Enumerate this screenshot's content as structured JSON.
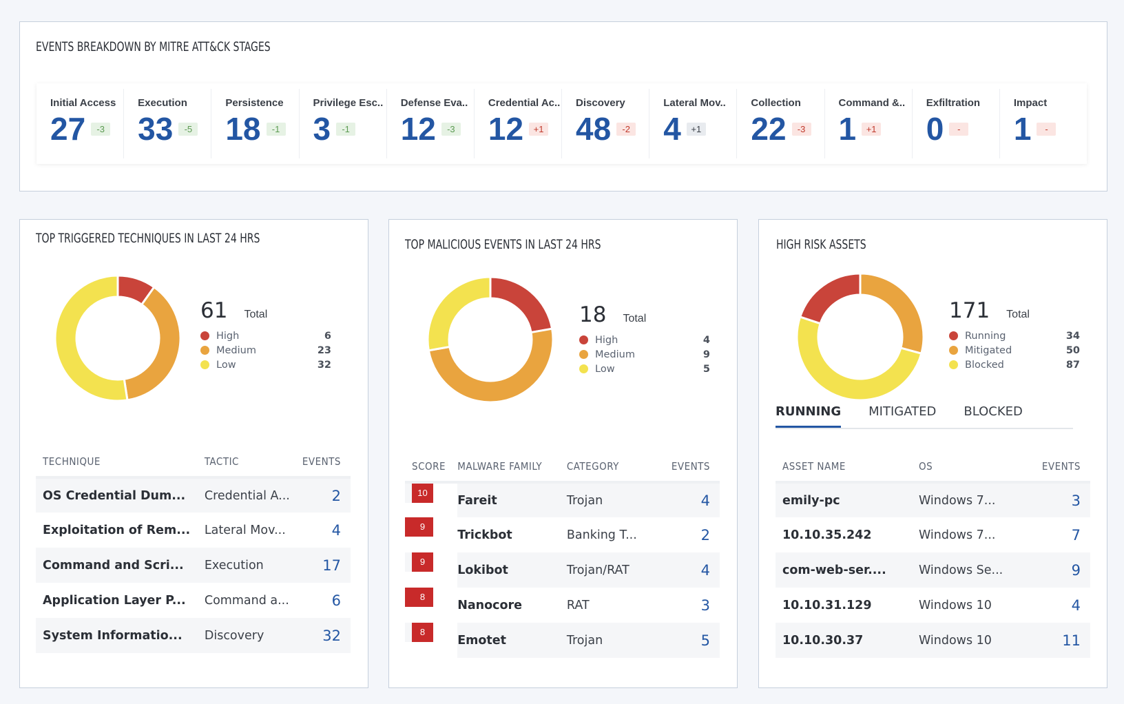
{
  "colors": {
    "high": "#c9443a",
    "medium": "#e9a43f",
    "low": "#f3e24f",
    "accent": "#2356a3"
  },
  "mitre": {
    "title": "EVENTS BREAKDOWN BY MITRE ATT&CK STAGES",
    "stages": [
      {
        "label": "Initial Access",
        "value": "27",
        "delta": "-3",
        "tone": "green"
      },
      {
        "label": "Execution",
        "value": "33",
        "delta": "-5",
        "tone": "green"
      },
      {
        "label": "Persistence",
        "value": "18",
        "delta": "-1",
        "tone": "green"
      },
      {
        "label": "Privilege Esc..",
        "value": "3",
        "delta": "-1",
        "tone": "green"
      },
      {
        "label": "Defense Eva..",
        "value": "12",
        "delta": "-3",
        "tone": "green"
      },
      {
        "label": "Credential Ac..",
        "value": "12",
        "delta": "+1",
        "tone": "red"
      },
      {
        "label": "Discovery",
        "value": "48",
        "delta": "-2",
        "tone": "red"
      },
      {
        "label": "Lateral Mov..",
        "value": "4",
        "delta": "+1",
        "tone": "gray"
      },
      {
        "label": "Collection",
        "value": "22",
        "delta": "-3",
        "tone": "red"
      },
      {
        "label": "Command &..",
        "value": "1",
        "delta": "+1",
        "tone": "red"
      },
      {
        "label": "Exfiltration",
        "value": "0",
        "delta": "-",
        "tone": "red"
      },
      {
        "label": "Impact",
        "value": "1",
        "delta": "-",
        "tone": "red"
      }
    ]
  },
  "techniques": {
    "title": "TOP TRIGGERED TECHNIQUES IN LAST 24 HRS",
    "donut": {
      "total": "61",
      "total_label": "Total",
      "segments": [
        {
          "label": "High",
          "value": 6,
          "color": "#c9443a"
        },
        {
          "label": "Medium",
          "value": 23,
          "color": "#e9a43f"
        },
        {
          "label": "Low",
          "value": 32,
          "color": "#f3e24f"
        }
      ]
    },
    "columns": [
      "TECHNIQUE",
      "TACTIC",
      "EVENTS"
    ],
    "rows": [
      [
        "OS Credential Dum...",
        "Credential A...",
        "2"
      ],
      [
        "Exploitation of Rem...",
        "Lateral Mov...",
        "4"
      ],
      [
        "Command and Scri...",
        "Execution",
        "17"
      ],
      [
        "Application Layer P...",
        "Command a...",
        "6"
      ],
      [
        "System Informatio...",
        "Discovery",
        "32"
      ]
    ]
  },
  "malicious": {
    "title": "TOP MALICIOUS EVENTS IN LAST 24 HRS",
    "donut": {
      "total": "18",
      "total_label": "Total",
      "segments": [
        {
          "label": "High",
          "value": 4,
          "color": "#c9443a"
        },
        {
          "label": "Medium",
          "value": 9,
          "color": "#e9a43f"
        },
        {
          "label": "Low",
          "value": 5,
          "color": "#f3e24f"
        }
      ]
    },
    "columns": [
      "SCORE",
      "MALWARE FAMILY",
      "CATEGORY",
      "EVENTS"
    ],
    "rows": [
      [
        "10",
        "Fareit",
        "Trojan",
        "4"
      ],
      [
        "9",
        "Trickbot",
        "Banking T...",
        "2"
      ],
      [
        "9",
        "Lokibot",
        "Trojan/RAT",
        "4"
      ],
      [
        "8",
        "Nanocore",
        "RAT",
        "3"
      ],
      [
        "8",
        "Emotet",
        "Trojan",
        "5"
      ]
    ]
  },
  "assets": {
    "title": "HIGH RISK ASSETS",
    "donut": {
      "total": "171",
      "total_label": "Total",
      "segments": [
        {
          "label": "Running",
          "value": 34,
          "color": "#c9443a"
        },
        {
          "label": "Mitigated",
          "value": 50,
          "color": "#e9a43f"
        },
        {
          "label": "Blocked",
          "value": 87,
          "color": "#f3e24f"
        }
      ]
    },
    "tabs": [
      "RUNNING",
      "MITIGATED",
      "BLOCKED"
    ],
    "active_tab": "RUNNING",
    "columns": [
      "ASSET NAME",
      "OS",
      "EVENTS"
    ],
    "rows": [
      [
        "emily-pc",
        "Windows 7...",
        "3"
      ],
      [
        "10.10.35.242",
        "Windows 7...",
        "7"
      ],
      [
        "com-web-ser....",
        "Windows Se...",
        "9"
      ],
      [
        "10.10.31.129",
        "Windows 10",
        "4"
      ],
      [
        "10.10.30.37",
        "Windows 10",
        "11"
      ]
    ]
  }
}
